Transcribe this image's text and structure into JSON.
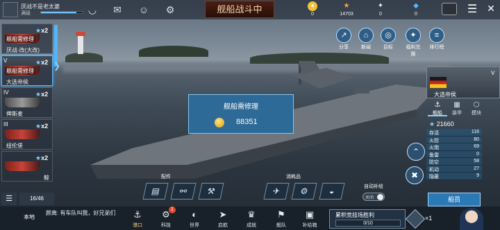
{
  "header": {
    "player_name": "厌战不是老太婆",
    "player_sub": "满级",
    "exp_fraction": 0.85,
    "title": "舰船战斗中",
    "resources": [
      {
        "icon": "gold-coin-icon",
        "value": "0",
        "color": "#f1c232"
      },
      {
        "icon": "star-icon",
        "value": "14703",
        "color": "#f3a63b"
      },
      {
        "icon": "white-star-icon",
        "value": "0",
        "color": "#eaeaea"
      },
      {
        "icon": "blue-diamond-icon",
        "value": "0",
        "color": "#58b6ff"
      }
    ]
  },
  "fleet": {
    "slots": [
      {
        "tier": "",
        "stars": "x2",
        "name": "厌战·改(大改)",
        "repair": "舰船需修理"
      },
      {
        "tier": "V",
        "stars": "x2",
        "name": "大选帝侯",
        "repair": "舰船需修理"
      },
      {
        "tier": "IV",
        "stars": "x2",
        "name": "俾斯麦",
        "repair": ""
      },
      {
        "tier": "III",
        "stars": "x2",
        "name": "纽伦堡",
        "repair": ""
      },
      {
        "tier": "",
        "stars": "x2",
        "name": "鲸",
        "repair": ""
      }
    ],
    "count": "16/46"
  },
  "popup": {
    "message": "舰船需修理",
    "cost": "88351"
  },
  "features": [
    {
      "label": "分享",
      "glyph": "↗"
    },
    {
      "label": "新闻",
      "glyph": "⌂"
    },
    {
      "label": "目标",
      "glyph": "◎"
    },
    {
      "label": "福利兑换",
      "glyph": "✦"
    },
    {
      "label": "排行榜",
      "glyph": "≡"
    }
  ],
  "ship_panel": {
    "tier_badge": "V",
    "name": "大选帝侯",
    "tabs": [
      "舰船",
      "装甲",
      "模块"
    ],
    "power": "21660",
    "stats": [
      {
        "k": "存活",
        "v": "116"
      },
      {
        "k": "火控",
        "v": "80"
      },
      {
        "k": "火炮",
        "v": "69"
      },
      {
        "k": "鱼雷",
        "v": "0"
      },
      {
        "k": "防空",
        "v": "58"
      },
      {
        "k": "机动",
        "v": "27"
      },
      {
        "k": "隐蔽",
        "v": "9"
      }
    ],
    "crew_label": "船员"
  },
  "quick": {
    "parts_label": "配件",
    "consumables_label": "消耗品",
    "auto_label": "自动补给",
    "auto_state": "关闭"
  },
  "bottom": {
    "channel": "本地",
    "chat_message": "颜离: 有车队叫我，好兄弟们",
    "nav": [
      {
        "label": "港口",
        "glyph": "⚓",
        "active": true
      },
      {
        "label": "科技",
        "glyph": "⚙",
        "badge": "1"
      },
      {
        "label": "世界",
        "glyph": "◐"
      },
      {
        "label": "启航",
        "glyph": "➤"
      },
      {
        "label": "成就",
        "glyph": "♛"
      },
      {
        "label": "舰队",
        "glyph": "⚑"
      },
      {
        "label": "补给箱",
        "glyph": "▣"
      }
    ],
    "arena_title": "累积竞技场胜利",
    "arena_progress": "0/10",
    "reward_count": "×1"
  }
}
